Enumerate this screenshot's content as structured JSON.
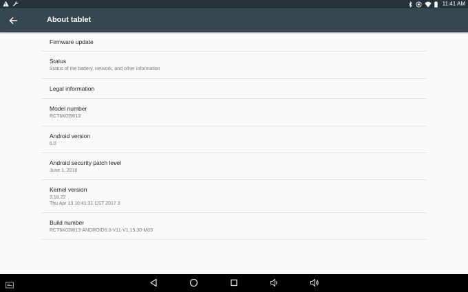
{
  "status_bar": {
    "time": "11:41 AM",
    "left_icons": [
      "warning-icon",
      "wrench-icon"
    ],
    "right_icons": [
      "bluetooth-icon",
      "sync-icon",
      "wifi-icon",
      "battery-icon"
    ]
  },
  "app_bar": {
    "title": "About tablet",
    "back_icon": "arrow-back-icon"
  },
  "items": [
    {
      "title": "Firmware update",
      "summary": ""
    },
    {
      "title": "Status",
      "summary": "Status of the battery, network, and other information"
    },
    {
      "title": "Legal information",
      "summary": ""
    },
    {
      "title": "Model number",
      "summary": "RCT6K03W13"
    },
    {
      "title": "Android version",
      "summary": "6.0"
    },
    {
      "title": "Android security patch level",
      "summary": "June 1, 2016"
    },
    {
      "title": "Kernel version",
      "summary": "3.18.22",
      "summary2": "Thu Apr 13 10:41:31 CST 2017 3"
    },
    {
      "title": "Build number",
      "summary": "RCT6K03W13-ANDROID6.0-V11-V1.15.30-M03"
    }
  ],
  "nav_bar": {
    "icons": [
      "screenshot-icon",
      "back-icon",
      "home-icon",
      "recents-icon",
      "volume-down-icon",
      "volume-up-icon"
    ]
  }
}
